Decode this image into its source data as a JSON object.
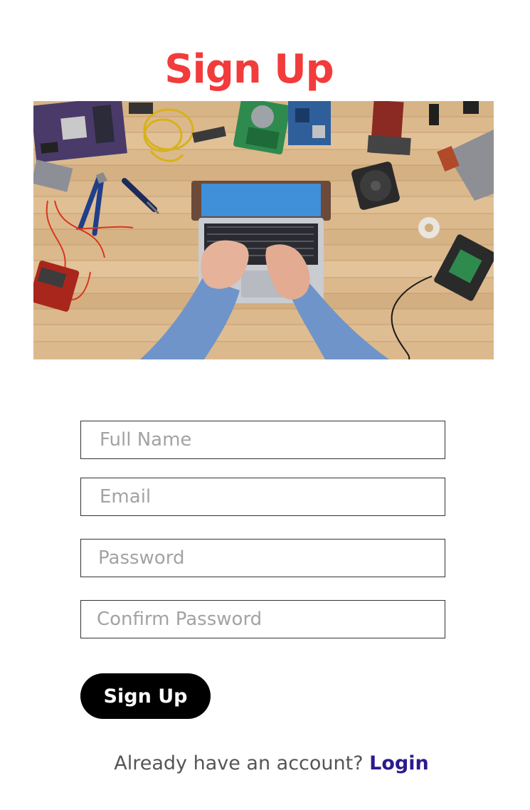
{
  "page": {
    "title": "Sign Up"
  },
  "hero": {
    "alt": "Top view of hands typing on a laptop on a wooden desk surrounded by computer parts"
  },
  "form": {
    "full_name": {
      "placeholder": "Full Name",
      "value": ""
    },
    "email": {
      "placeholder": "Email",
      "value": ""
    },
    "password": {
      "placeholder": "Password",
      "value": ""
    },
    "confirm_password": {
      "placeholder": "Confirm Password",
      "value": ""
    },
    "submit_label": "Sign Up"
  },
  "footer": {
    "prompt": "Already have an account?",
    "login_label": "Login"
  },
  "colors": {
    "title": "#f23b3b",
    "button_bg": "#000000",
    "button_text": "#ffffff",
    "link": "#2a1a8e",
    "placeholder": "#a3a3a3",
    "field_border": "#333333"
  }
}
